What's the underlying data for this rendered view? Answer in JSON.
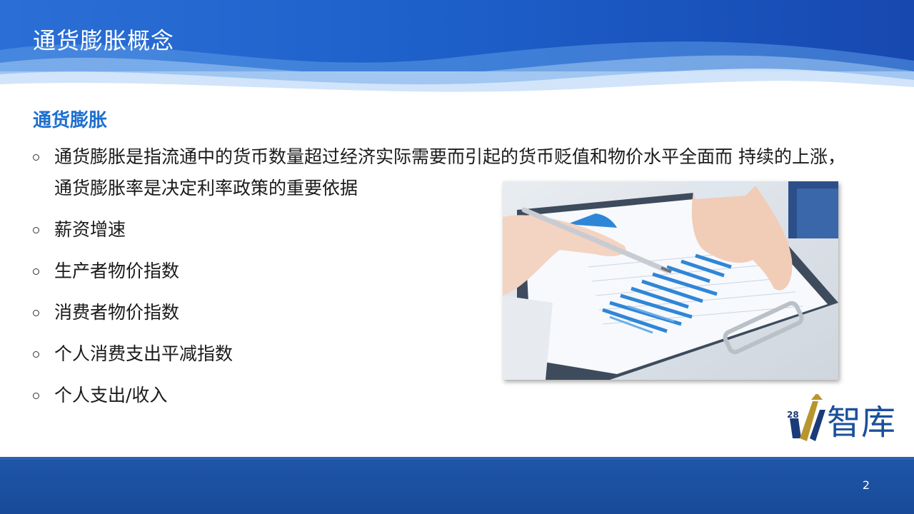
{
  "slide": {
    "title": "通货膨胀概念",
    "section_title": "通货膨胀",
    "bullets": [
      "通货膨胀是指流通中的货币数量超过经济实际需要而引起的货币贬值和物价水平全面而  持续的上涨，通货膨胀率是决定利率政策的重要依据",
      "薪资增速",
      "生产者物价指数",
      "消费者物价指数",
      "个人消费支出平减指数",
      "个人支出/收入"
    ],
    "page_number": "2"
  },
  "logo": {
    "number": "28",
    "text": "智库"
  },
  "colors": {
    "header_blue": "#1d5fc9",
    "section_title_blue": "#1e6fd0",
    "footer_blue": "#1a4f9f",
    "logo_gold": "#b8962e",
    "logo_navy": "#1b3a7a"
  }
}
